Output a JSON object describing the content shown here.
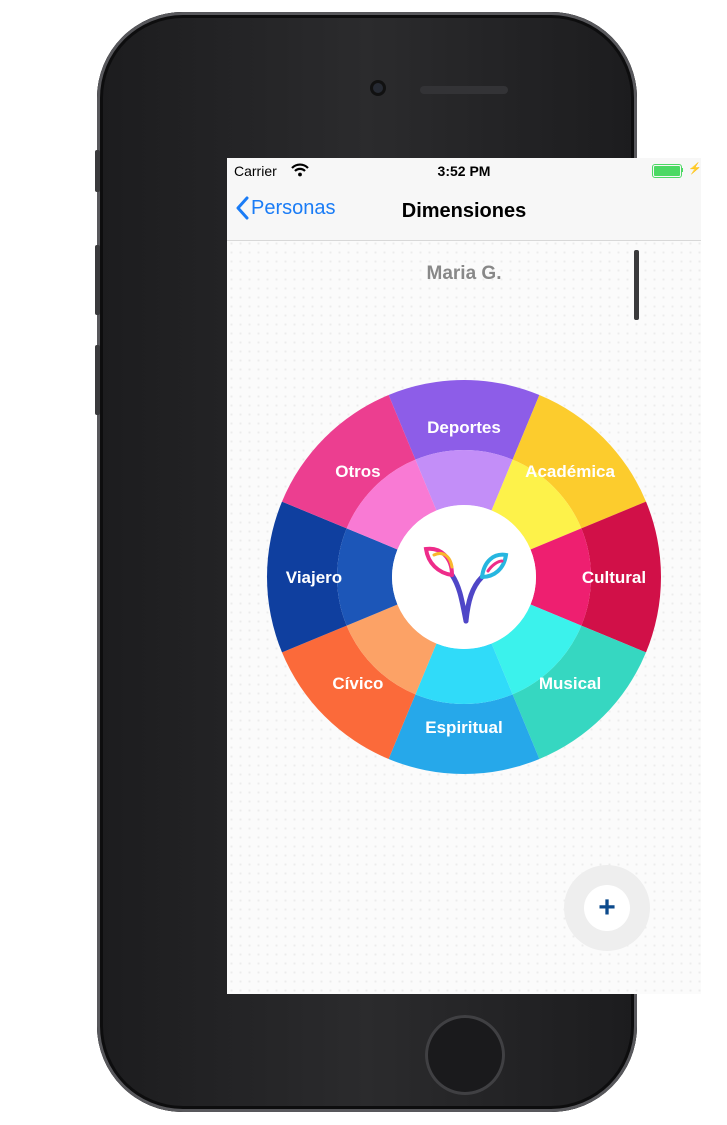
{
  "status_bar": {
    "carrier": "Carrier",
    "time": "3:52 PM"
  },
  "nav": {
    "back_label": "Personas",
    "title": "Dimensiones"
  },
  "person": {
    "name": "Maria G."
  },
  "wheel": {
    "segments": [
      {
        "label": "Deportes",
        "outer": "#8d5de8",
        "inner": "#c38ef8"
      },
      {
        "label": "Académica",
        "outer": "#fccc2d",
        "inner": "#fdf24a"
      },
      {
        "label": "Cultural",
        "outer": "#d11048",
        "inner": "#ee1f70"
      },
      {
        "label": "Musical",
        "outer": "#36d7c1",
        "inner": "#3bf2ec"
      },
      {
        "label": "Espiritual",
        "outer": "#26a8ea",
        "inner": "#30dbf9"
      },
      {
        "label": "Cívico",
        "outer": "#fb6a3a",
        "inner": "#fca266"
      },
      {
        "label": "Viajero",
        "outer": "#0f3f9f",
        "inner": "#1c56b8"
      },
      {
        "label": "Otros",
        "outer": "#ec3e90",
        "inner": "#f97ad4"
      }
    ]
  },
  "logo": {
    "icon": "sprout-logo-icon",
    "colors": [
      "#4f46c7",
      "#ee2c8a",
      "#f9b72d",
      "#26b6e0"
    ]
  },
  "fab": {
    "icon": "plus-icon",
    "label": "+",
    "color": "#0c4a8c"
  },
  "colors": {
    "accent": "#1a7cf6",
    "battery": "#4cd964"
  }
}
